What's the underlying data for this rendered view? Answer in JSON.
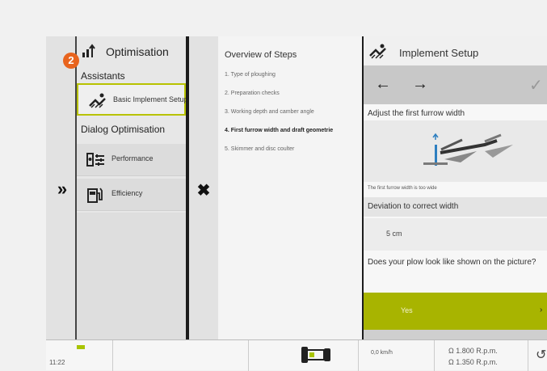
{
  "badge": "2",
  "optimisation": {
    "title": "Optimisation",
    "section_assistants": "Assistants",
    "section_dialog": "Dialog Optimisation",
    "items": [
      {
        "label": "Basic Implement Setup",
        "icon": "plough-icon",
        "active": true
      },
      {
        "label": "Performance",
        "icon": "performance-icon",
        "active": false
      },
      {
        "label": "Efficiency",
        "icon": "fuel-icon",
        "active": false
      }
    ]
  },
  "steps": {
    "title": "Overview of Steps",
    "items": [
      {
        "label": "1. Type of ploughing",
        "active": false
      },
      {
        "label": "2. Preparation checks",
        "active": false
      },
      {
        "label": "3. Working depth and camber angle",
        "active": false
      },
      {
        "label": "4. First furrow width and draft geometrie",
        "active": true
      },
      {
        "label": "5. Skimmer and disc coulter",
        "active": false
      }
    ]
  },
  "implement": {
    "title": "Implement Setup",
    "nav_back": "←",
    "nav_forward": "→",
    "nav_confirm": "✓",
    "instruction": "Adjust the first furrow width",
    "caption": "The first furrow width is too wide",
    "deviation_label": "Deviation to correct width",
    "deviation_value": "5 cm",
    "question": "Does your plow look like shown on the picture?",
    "yes_label": "Yes",
    "yes_chevron": "›"
  },
  "controls": {
    "expand": "»",
    "close": "✖"
  },
  "status": {
    "time": "11:22",
    "speed": "0,0 km/h",
    "rpm_front": "1.800 R.p.m.",
    "rpm_rear": "1.350 R.p.m.",
    "pto_symbol": "Ω",
    "gauge": "↺"
  },
  "colors": {
    "accent": "#a8b400",
    "badge": "#e8641e"
  }
}
